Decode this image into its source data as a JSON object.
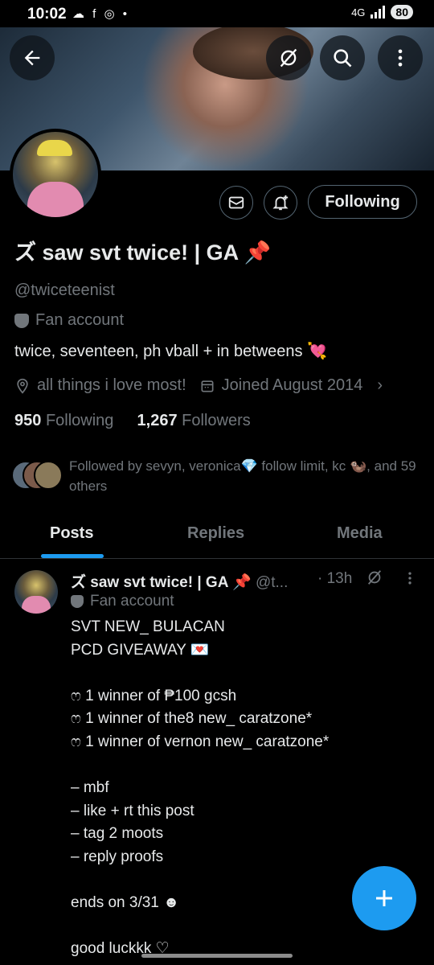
{
  "status_bar": {
    "time": "10:02",
    "icons": "☁ f ◎ •",
    "network": "4G",
    "battery": "80"
  },
  "profile": {
    "name": "ズ saw svt twice! | GA 📌",
    "handle": "@twiceteenist",
    "category": "Fan account",
    "bio": "twice, seventeen, ph vball + in betweens 💘",
    "location": "all things i love most!",
    "joined": "Joined August 2014",
    "following_count": "950",
    "following_label": "Following",
    "followers_count": "1,267",
    "followers_label": "Followers",
    "follow_button": "Following",
    "followed_by": "Followed by sevyn, veronica💎 follow limit, kc 🦦, and 59 others"
  },
  "tabs": [
    "Posts",
    "Replies",
    "Media"
  ],
  "post": {
    "name": "ズ saw svt twice! | GA 📌",
    "handle": "@t...",
    "time": "· 13h",
    "category": "Fan account",
    "body": "SVT NEW_ BULACAN\nPCD GIVEAWAY 💌\n\nෆ 1 winner of ₱100 gcsh\nෆ 1 winner of the8 new_ caratzone*\nෆ 1 winner of vernon new_ caratzone*\n\n– mbf\n– like + rt this post\n– tag 2 moots\n– reply proofs\n\nends on 3/31 ☻\n\ngood luckkk ♡"
  },
  "colors": {
    "accent": "#1d9bf0",
    "muted": "#71767b",
    "text": "#e7e9ea",
    "border": "#536471"
  }
}
